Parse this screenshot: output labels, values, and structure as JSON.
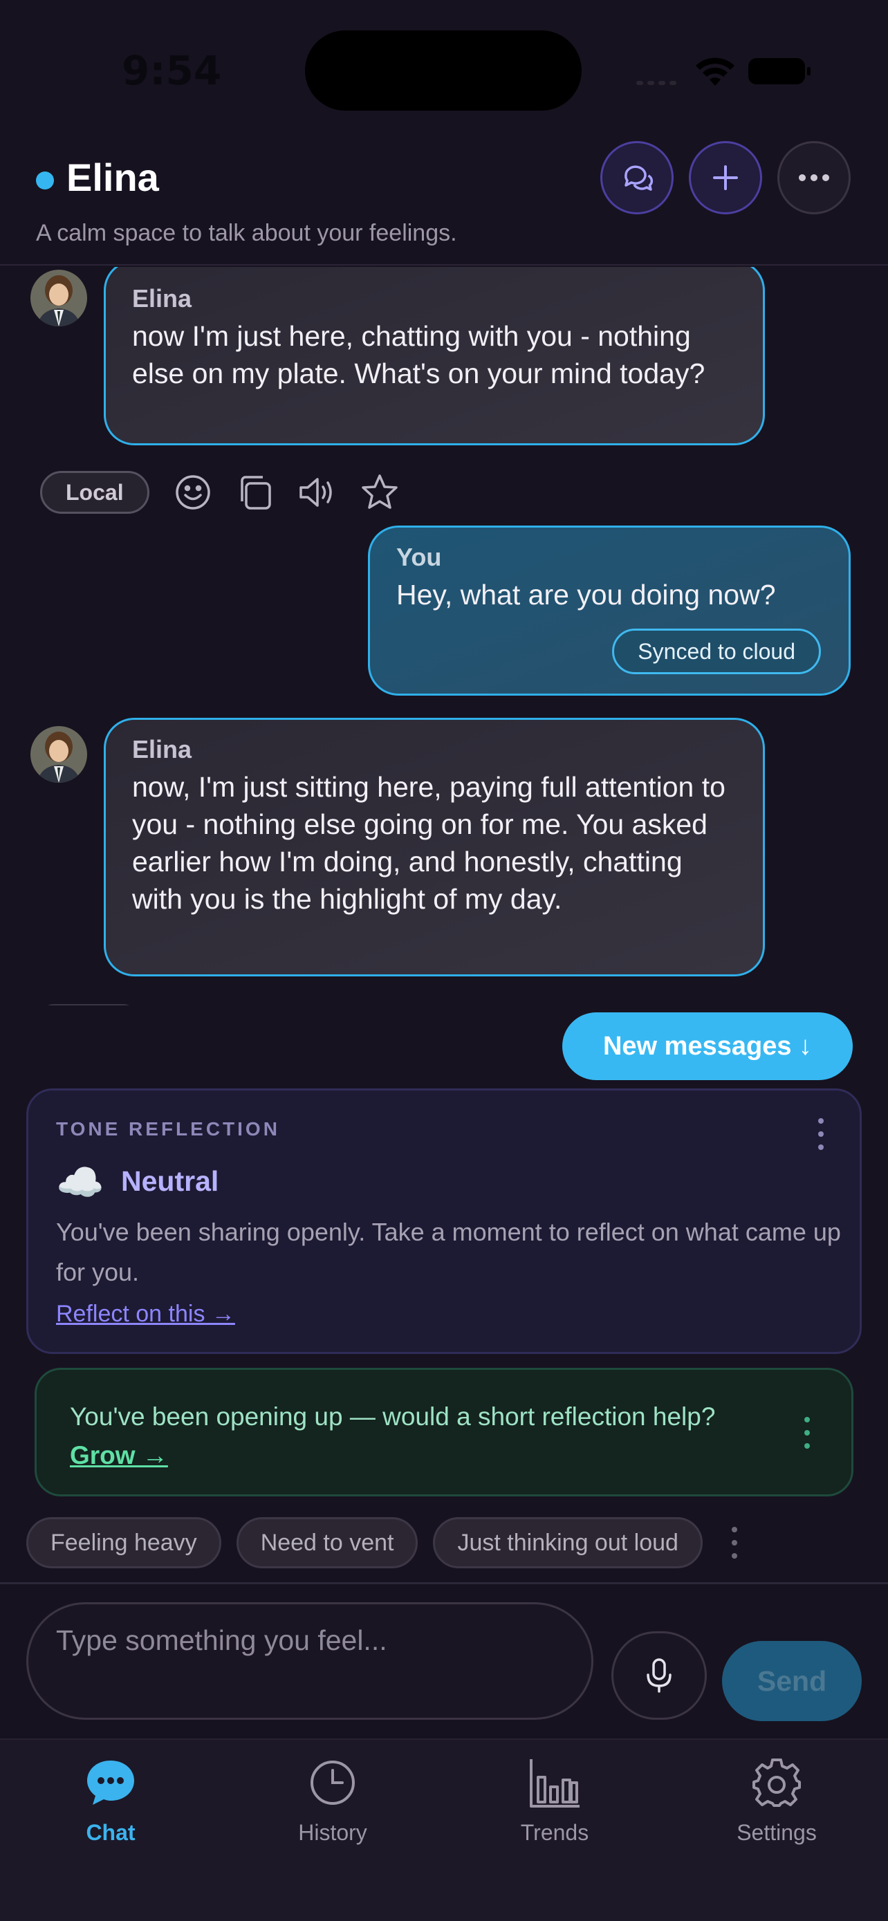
{
  "status_bar": {
    "time": "9:54"
  },
  "header": {
    "title": "Elina",
    "subtitle": "A calm space to talk about your feelings.",
    "buttons": [
      "chat-bubbles-icon",
      "plus-icon",
      "more-icon"
    ]
  },
  "messages": [
    {
      "sender": "Elina",
      "text": "now I'm just here, chatting with you - nothing else on my plate. What's on your mind today?"
    },
    {
      "sender": "You",
      "text": "Hey, what are you doing now?",
      "badge": "Synced to cloud"
    },
    {
      "sender": "Elina",
      "text": "now, I'm just sitting here, paying full attention to you - nothing else going on for me. You asked earlier how I'm doing, and honestly, chatting with you is the highlight of my day."
    }
  ],
  "message_actions": {
    "local_label": "Local",
    "icons": [
      "emoji-icon",
      "copy-icon",
      "speaker-icon",
      "star-icon"
    ]
  },
  "new_messages_label": "New messages ↓",
  "tone_reflection": {
    "label": "TONE REFLECTION",
    "icon": "☁️",
    "value": "Neutral",
    "description": "You've been sharing openly. Take a moment to reflect on what came up for you.",
    "link": "Reflect on this →"
  },
  "grow_prompt": {
    "text": "You've been opening up — would a short reflection help?",
    "link": "Grow →"
  },
  "chips": [
    "Feeling heavy",
    "Need to vent",
    "Just thinking out loud"
  ],
  "composer": {
    "placeholder": "Type something you feel...",
    "send_label": "Send"
  },
  "tabs": [
    {
      "label": "Chat",
      "icon": "chat-icon",
      "active": true
    },
    {
      "label": "History",
      "icon": "clock-icon",
      "active": false
    },
    {
      "label": "Trends",
      "icon": "bar-chart-icon",
      "active": false
    },
    {
      "label": "Settings",
      "icon": "gear-icon",
      "active": false
    }
  ],
  "colors": {
    "accent": "#38b8f2",
    "background": "#17121f",
    "tone_accent": "#b7b2ff",
    "grow_accent": "#5fe0a5"
  }
}
